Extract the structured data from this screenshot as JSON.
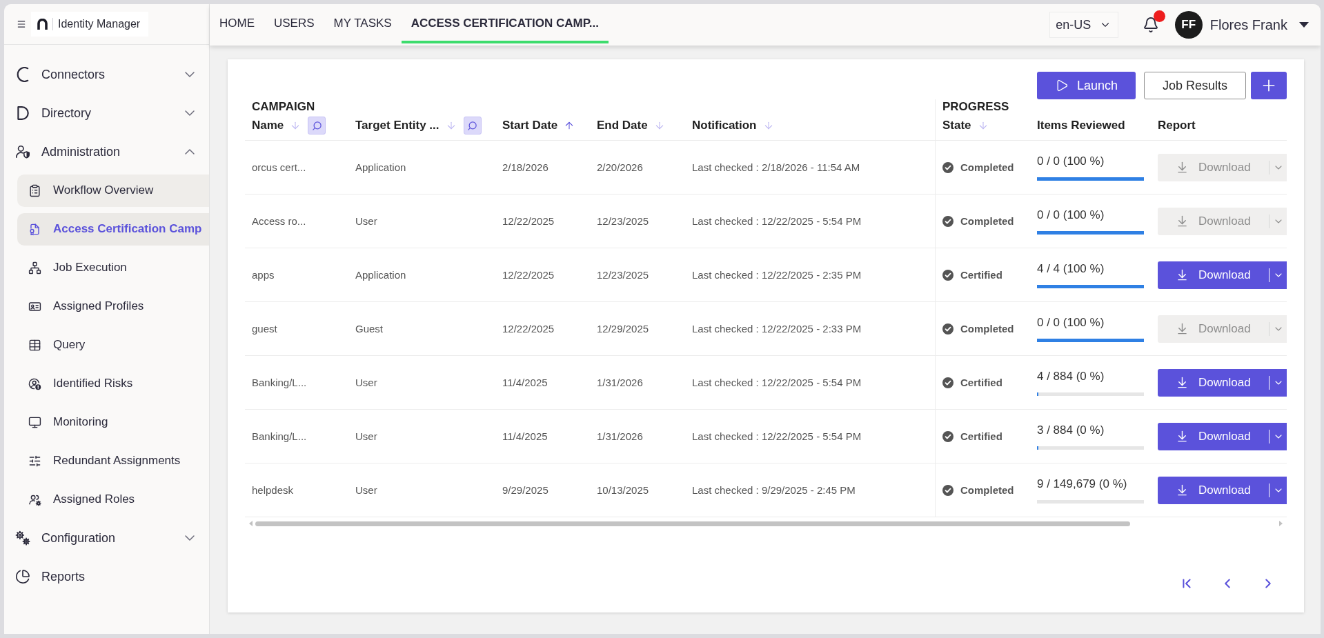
{
  "sidebar": {
    "logo_text": "Identity Manager",
    "items": [
      {
        "kind": "section",
        "label": "Connectors",
        "expanded": false,
        "selected": false
      },
      {
        "kind": "section",
        "label": "Directory",
        "expanded": false,
        "selected": false
      },
      {
        "kind": "section",
        "label": "Administration",
        "expanded": true,
        "selected": false,
        "children": [
          {
            "label": "Workflow Overview",
            "selected": false,
            "hovered": true
          },
          {
            "label": "Access Certification Camp",
            "selected": true,
            "hovered": false
          },
          {
            "label": "Job Execution",
            "selected": false,
            "hovered": false
          },
          {
            "label": "Assigned Profiles",
            "selected": false,
            "hovered": false
          },
          {
            "label": "Query",
            "selected": false,
            "hovered": false
          },
          {
            "label": "Identified Risks",
            "selected": false,
            "hovered": false
          },
          {
            "label": "Monitoring",
            "selected": false,
            "hovered": false
          },
          {
            "label": "Redundant Assignments",
            "selected": false,
            "hovered": false
          },
          {
            "label": "Assigned Roles",
            "selected": false,
            "hovered": false
          }
        ]
      },
      {
        "kind": "section",
        "label": "Configuration",
        "expanded": false,
        "selected": false
      },
      {
        "kind": "link",
        "label": "Reports",
        "selected": false
      }
    ]
  },
  "top_bar": {
    "tabs": [
      {
        "label": "HOME",
        "selected": false
      },
      {
        "label": "USERS",
        "selected": false
      },
      {
        "label": "MY TASKS",
        "selected": false
      },
      {
        "label": "ACCESS CERTIFICATION CAMP...",
        "selected": true
      }
    ],
    "language": "en-US",
    "notifications": {
      "unread": true
    },
    "user": {
      "initials": "FF",
      "name": "Flores Frank"
    }
  },
  "toolbar": {
    "buttons": [
      {
        "kind": "launch",
        "label": "Launch"
      },
      {
        "kind": "results",
        "label": "Job Results"
      },
      {
        "kind": "add"
      }
    ]
  },
  "table": {
    "columns": [
      {
        "group": "CAMPAIGN",
        "label": "Name",
        "sortable": true,
        "sorted": false,
        "filter": true
      },
      {
        "label": "Target Entity ...",
        "sortable": true,
        "sorted": false,
        "filter": true
      },
      {
        "label": "Start Date",
        "sortable": true,
        "sorted": true,
        "filter": false
      },
      {
        "label": "End Date",
        "sortable": true,
        "sorted": false,
        "filter": false
      },
      {
        "label": "Notification",
        "sortable": true,
        "sorted": false,
        "filter": false
      },
      {
        "group": "PROGRESS",
        "label": "State",
        "sortable": true,
        "sorted": false,
        "filter": false
      },
      {
        "label": "Items Reviewed",
        "sortable": false,
        "sorted": false,
        "filter": false
      },
      {
        "label": "Report",
        "sortable": false,
        "sorted": false,
        "filter": false
      }
    ],
    "rows": [
      {
        "name": "orcus cert...",
        "target": "Application",
        "start_date": "2/18/2026",
        "end_date": "2/20/2026",
        "notification": "Last checked : 2/18/2026 - 11:54 AM",
        "state": "Completed",
        "items_reviewed": "0 / 0 (100 %)",
        "level": 1,
        "download": {
          "label": "Download",
          "disabled": true
        }
      },
      {
        "name": "Access ro...",
        "target": "User",
        "start_date": "12/22/2025",
        "end_date": "12/23/2025",
        "notification": "Last checked : 12/22/2025 - 5:54 PM",
        "state": "Completed",
        "items_reviewed": "0 / 0 (100 %)",
        "level": 1,
        "download": {
          "label": "Download",
          "disabled": true
        }
      },
      {
        "name": "apps",
        "target": "Application",
        "start_date": "12/22/2025",
        "end_date": "12/23/2025",
        "notification": "Last checked : 12/22/2025 - 2:35 PM",
        "state": "Certified",
        "items_reviewed": "4 / 4 (100 %)",
        "level": 1,
        "download": {
          "label": "Download",
          "disabled": false
        }
      },
      {
        "name": "guest",
        "target": "Guest",
        "start_date": "12/22/2025",
        "end_date": "12/29/2025",
        "notification": "Last checked : 12/22/2025 - 2:33 PM",
        "state": "Completed",
        "items_reviewed": "0 / 0 (100 %)",
        "level": 1,
        "download": {
          "label": "Download",
          "disabled": true
        }
      },
      {
        "name": "Banking/L...",
        "target": "User",
        "start_date": "11/4/2025",
        "end_date": "1/31/2026",
        "notification": "Last checked : 12/22/2025 - 5:54 PM",
        "state": "Certified",
        "items_reviewed": "4 / 884 (0 %)",
        "level": 0.01,
        "download": {
          "label": "Download",
          "disabled": false
        }
      },
      {
        "name": "Banking/L...",
        "target": "User",
        "start_date": "11/4/2025",
        "end_date": "1/31/2026",
        "notification": "Last checked : 12/22/2025 - 5:54 PM",
        "state": "Certified",
        "items_reviewed": "3 / 884 (0 %)",
        "level": 0.01,
        "download": {
          "label": "Download",
          "disabled": false
        }
      },
      {
        "name": "helpdesk",
        "target": "User",
        "start_date": "9/29/2025",
        "end_date": "10/13/2025",
        "notification": "Last checked : 9/29/2025 - 2:45 PM",
        "state": "Completed",
        "items_reviewed": "9 / 149,679 (0 %)",
        "level": 0,
        "download": {
          "label": "Download",
          "disabled": false
        }
      }
    ]
  }
}
